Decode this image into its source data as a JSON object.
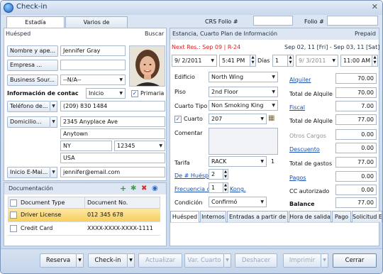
{
  "window": {
    "title": "Check-in",
    "close_glyph": "✕"
  },
  "tabs": {
    "stay": "Estadía",
    "misc": "Varios de Información"
  },
  "folio": {
    "crs_label": "CRS Folio #",
    "crs_value": "",
    "folio_label": "Folio #",
    "folio_value": ""
  },
  "guest": {
    "header": "Huésped",
    "search": "Buscar",
    "name_btn": "Nombre y ape...",
    "name_value": "Jennifer  Gray",
    "company_btn": "Empresa ...",
    "company_value": "",
    "source_btn": "Business Sour...",
    "source_value": "--N/A--",
    "contact_label": "Información de contac",
    "contact_type": "Inicio",
    "primary_label": "Primaria",
    "phone_btn": "Teléfono de...",
    "phone_value": "(209) 830 1484",
    "address_btn": "Domicilio...",
    "address1": "2345 Anyplace Ave",
    "address2": "Anytown",
    "state": "NY",
    "zip": "12345",
    "country": "USA",
    "email_btn": "Inicio E-Mai...",
    "email_value": "jennifer@email.com"
  },
  "docs": {
    "header": "Documentación",
    "col_type": "Document Type",
    "col_no": "Document No.",
    "rows": [
      {
        "type": "Driver License",
        "no": "012 345 678"
      },
      {
        "type": "Credit Card",
        "no": "XXXX-XXXX-XXXX-1111"
      }
    ]
  },
  "stay": {
    "header": "Estancia, Cuarto Plan de Información",
    "prepaid": "Prepaid",
    "next_res": "Next Res.: Sep 09 | R-24",
    "range": "Sep 02, 11 [Fri] - Sep 03, 11 [Sat]",
    "arrive_date": "9/ 2/2011",
    "arrive_time": "5:41 PM",
    "days_label": "Días",
    "days_value": "1",
    "depart_date": "9/ 3/2011",
    "depart_time": "11:00 AM",
    "building_label": "Edificio",
    "building": "North Wing",
    "floor_label": "Piso",
    "floor": "2nd Floor",
    "roomtype_label": "Cuarto Tipo",
    "roomtype": "Non Smoking King",
    "room_label": "Cuarto",
    "room": "207",
    "comment_label": "Comentar",
    "rate_label": "Tarifa",
    "rate": "RACK",
    "rate_qty": "1",
    "guests_label": "De # Huésped",
    "guests": "2",
    "freq_label": "Frecuencia d",
    "freq_suffix": "Kong.",
    "freq": "1",
    "condition_label": "Condición",
    "condition": "Confirmó"
  },
  "totals": [
    {
      "label": "Alquiler",
      "value": "70.00",
      "link": true
    },
    {
      "label": "Total de Alquile",
      "value": "70.00",
      "link": false
    },
    {
      "label": "Fiscal",
      "value": "7.00",
      "link": true
    },
    {
      "label": "Total de Alquile",
      "value": "77.00",
      "link": false
    },
    {
      "label": "Otros Cargos",
      "value": "0.00",
      "link": false
    },
    {
      "label": "Descuento",
      "value": "0.00",
      "link": true
    },
    {
      "label": "Total de gastos",
      "value": "77.00",
      "link": false
    },
    {
      "label": "Pagos",
      "value": "0.00",
      "link": true
    },
    {
      "label": "CC autorizado",
      "value": "0.00",
      "link": false
    },
    {
      "label": "Balance",
      "value": "77.00",
      "link": false
    }
  ],
  "bottom_tabs": [
    "Huésped",
    "Internos",
    "Entradas a partir de",
    "Hora de salida",
    "Pago",
    "Solicitud Es"
  ],
  "buttons": {
    "reserve": "Reserva",
    "checkin": "Check-in",
    "update": "Actualizar",
    "room": "Var. Cuarto",
    "undo": "Deshacer",
    "print": "Imprimir",
    "close": "Cerrar"
  }
}
